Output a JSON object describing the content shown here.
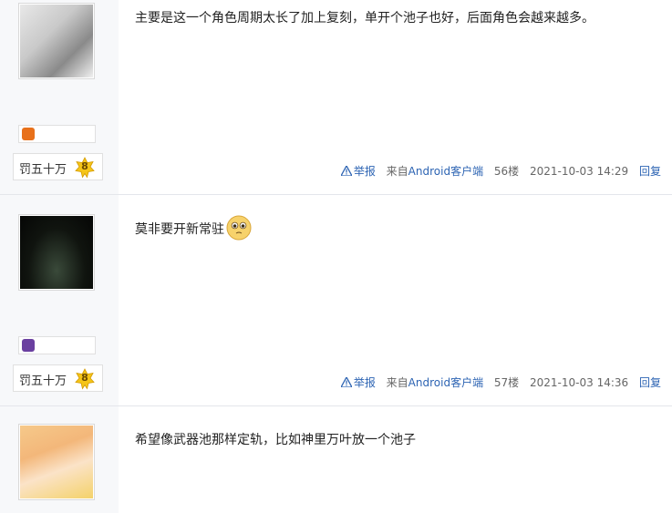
{
  "posts": [
    {
      "content": "主要是这一个角色周期太长了加上复刻，单开个池子也好，后面角色会越来越多。",
      "level_name": "罚五十万",
      "level": "8",
      "report_label": "举报",
      "source_prefix": "来自",
      "source_device": "Android客户端",
      "floor": "56楼",
      "datetime": "2021-10-03 14:29",
      "reply_label": "回复"
    },
    {
      "content": "莫非要开新常驻",
      "level_name": "罚五十万",
      "level": "8",
      "report_label": "举报",
      "source_prefix": "来自",
      "source_device": "Android客户端",
      "floor": "57楼",
      "datetime": "2021-10-03 14:36",
      "reply_label": "回复"
    },
    {
      "content": "希望像武器池那样定轨，比如神里万叶放一个池子"
    }
  ],
  "colors": {
    "link": "#2d64b3",
    "sidebar_bg": "#f7f8fa"
  }
}
